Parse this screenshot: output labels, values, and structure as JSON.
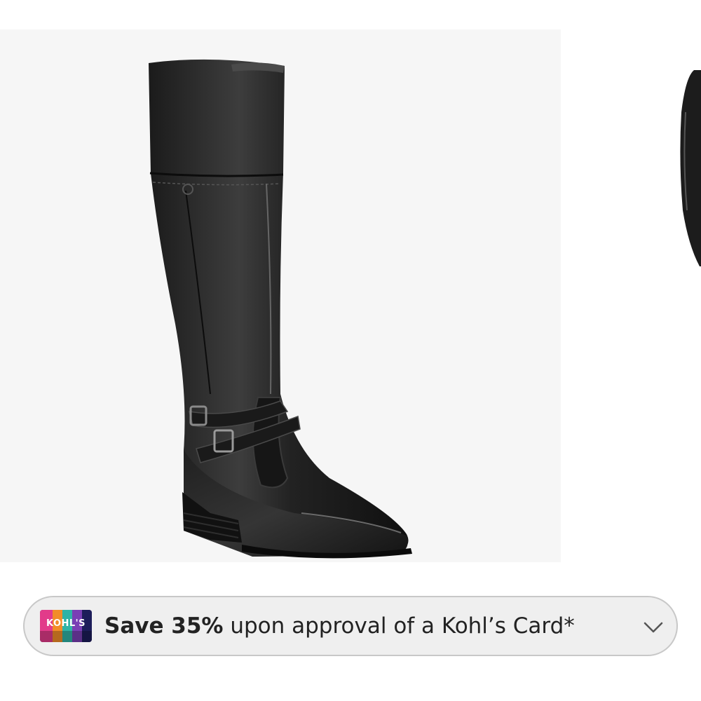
{
  "product_image": {
    "alt": "Black tall leather riding boot",
    "icon": "boot-image"
  },
  "promo_banner": {
    "card_brand": "KOHL'S",
    "save_text": "Save 35%",
    "rest_text": " upon approval of a Kohl’s Card*",
    "chevron_icon": "chevron-down-icon"
  },
  "colors": {
    "image_background": "#f6f6f6",
    "banner_background": "#efefef",
    "banner_border": "#c8c8c8",
    "text": "#222222"
  }
}
